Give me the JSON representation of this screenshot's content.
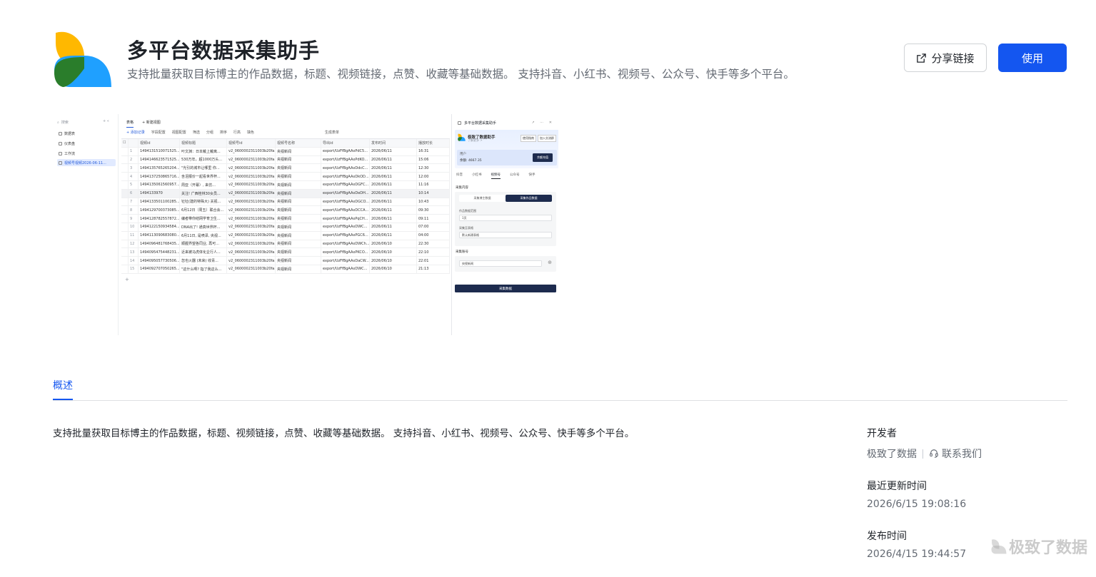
{
  "header": {
    "title": "多平台数据采集助手",
    "description": "支持批量获取目标博主的作品数据，标题、视频链接，点赞、收藏等基础数据。 支持抖音、小红书、视频号、公众号、快手等多个平台。",
    "share_label": "分享链接",
    "use_label": "使用"
  },
  "colors": {
    "accent": "#1456f0",
    "logo_yellow": "#ffb800",
    "logo_blue": "#1fa0ff",
    "logo_green": "#2a7d2b"
  },
  "preview": {
    "search": "搜索",
    "nav": [
      "数据表",
      "仪表盘",
      "工作流",
      "视频号视频2026-06-11..."
    ],
    "tabs": [
      "表格",
      "+ 新建视图"
    ],
    "toolbar": [
      "+ 添加记录",
      "字段配置",
      "视图配置",
      "筛选",
      "分组",
      "排序",
      "行高",
      "填色",
      "生成表单"
    ],
    "columns": [
      "视频id",
      "视频标题",
      "视频号id",
      "视频号名称",
      "导出id",
      "发布时间",
      "播放时长"
    ],
    "rows": [
      [
        "1494131510071525...",
        "叶文渊：日本戴上戴离...",
        "v2_0600002311003b20fa...",
        "央视新闻",
        "export/UzFfBgAAxPdC5...",
        "2026/06/11",
        "16:31"
      ],
      [
        "1494146623571525...",
        "530万年，超1000万头...",
        "v2_0600002311003b20fa...",
        "央视新闻",
        "export/UzFfBgAAxPdKO...",
        "2026/06/11",
        "15:06"
      ],
      [
        "1494135765265204...",
        "\"光引的城市让哪里 你...",
        "v2_0600002311003b20fa...",
        "央视新闻",
        "export/UzFfBgAAxDdcC...",
        "2026/06/11",
        "12:30"
      ],
      [
        "1494137250865716...",
        "含泪报价一起看世界杯...",
        "v2_0600002311003b20fa...",
        "央视新闻",
        "export/UzFfBgAAxDkOD...",
        "2026/06/11",
        "12:00"
      ],
      [
        "1494135061560957...",
        "周亚（开幕）, 来仿...",
        "v2_0600002311003b20fa...",
        "央视新闻",
        "export/UzFfBgAAxDGFC...",
        "2026/06/11",
        "11:16"
      ],
      [
        "1494133970",
        "关注! 广西桂林30女员...",
        "v2_0600002311003b20fa...",
        "央视新闻",
        "export/UzFfBgAAxDeDH...",
        "2026/06/11",
        "10:14"
      ],
      [
        "1494133501100285...",
        "钍钍(建的特殊大) 关视...",
        "v2_0600002311003b20fa...",
        "央视新闻",
        "export/UzFfBgAAxDGCO...",
        "2026/06/11",
        "10:43"
      ],
      [
        "1494129700373085...",
        "6月12日（周五）联合会...",
        "v2_0600002311003b20fa...",
        "央视新闻",
        "export/UzFfBgAAxDCCA...",
        "2026/06/11",
        "09:30"
      ],
      [
        "1494128782557872...",
        "编者带你结网学育卫生...",
        "v2_0600002311003b20fa...",
        "央视新闻",
        "export/UzFfBgAAxPqCH...",
        "2026/06/11",
        "09:11"
      ],
      [
        "1494122150934584...",
        "DNA出了! 通真世界杯...",
        "v2_0600002311003b20fa...",
        "央视新闻",
        "export/UzFfBgAAxDWC...",
        "2026/06/11",
        "07:00"
      ],
      [
        "1494113090683080...",
        "6月11日, 是喷泽, 央视...",
        "v2_0600002311003b20fa...",
        "央视新闻",
        "export/UzFfBgAAxPGC6...",
        "2026/06/11",
        "04:00"
      ],
      [
        "1494096481768435...",
        "顺握界望各同业, 再可...",
        "v2_0600002311003b20fa...",
        "央视新闻",
        "export/UzFfBgAAxDWCh...",
        "2026/06/10",
        "22:30"
      ],
      [
        "1494095475448231...",
        "近来被马虎体化企行人...",
        "v2_0600002311003b20fa...",
        "央视新闻",
        "export/UzFfBgAAxPKCO...",
        "2026/06/10",
        "22:10"
      ],
      [
        "1494095057730506...",
        "忽也火器 (未来) 收青...",
        "v2_0600002311003b20fa...",
        "央视新闻",
        "export/UzFfBgAAxDaCW...",
        "2026/06/10",
        "22:01"
      ],
      [
        "1494092707050265...",
        "\"这什么啊? 指了我这么...",
        "v2_0600002311003b20fa...",
        "央视新闻",
        "export/UzFfBgAAxDWC...",
        "2026/06/10",
        "21:13"
      ]
    ],
    "panel": {
      "title": "多平台数据采集助手",
      "brand": "极致了数据助手",
      "brand_sub": "了解更多 >",
      "hero_btn_1": "使用指南",
      "hero_btn_2": "加入交流群",
      "user_label": "用户",
      "balance_label": "余额: 4667.35",
      "recharge": "余额充值",
      "platforms": [
        "抖音",
        "小红书",
        "视频号",
        "公众号",
        "快手"
      ],
      "section_content": "采集内容",
      "seg_1": "采集博主数据",
      "seg_2": "采集作品数据",
      "label_range": "作品数据范围",
      "value_range": "1页",
      "label_table": "采集至表格",
      "value_table": "默认新建表格",
      "section_account": "采集账号",
      "account_placeholder": "央视新闻",
      "go": "采集数据"
    }
  },
  "tabs": {
    "overview": "概述"
  },
  "body": {
    "description": "支持批量获取目标博主的作品数据，标题、视频链接，点赞、收藏等基础数据。 支持抖音、小红书、视频号、公众号、快手等多个平台。"
  },
  "side": {
    "developer_label": "开发者",
    "developer_name": "极致了数据",
    "contact_label": "联系我们",
    "updated_label": "最近更新时间",
    "updated_value": "2026/6/15 19:08:16",
    "published_label": "发布时间",
    "published_value": "2026/4/15 19:44:57"
  },
  "watermark": "极致了数据"
}
